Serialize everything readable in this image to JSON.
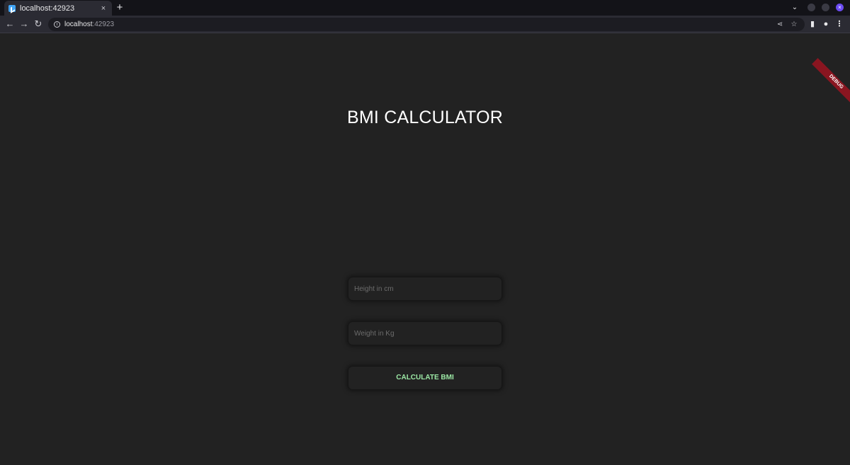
{
  "browser": {
    "tab": {
      "title": "localhost:42923",
      "close_glyph": "×"
    },
    "new_tab_glyph": "+",
    "tab_search_glyph": "⌄",
    "window_close_glyph": "×",
    "address": {
      "host": "localhost",
      "port": ":42923"
    },
    "nav": {
      "back_glyph": "←",
      "forward_glyph": "→",
      "reload_glyph": "↻"
    },
    "icons": {
      "share_glyph": "⋖",
      "star_glyph": "☆",
      "sidepanel_glyph": "▮",
      "profile_glyph": "●",
      "menu_glyph": "⋮"
    }
  },
  "debug_banner": "DEBUG",
  "app": {
    "title": "BMI CALCULATOR",
    "height_input": {
      "placeholder": "Height in cm",
      "value": ""
    },
    "weight_input": {
      "placeholder": "Weight in Kg",
      "value": ""
    },
    "calculate_button": "CALCULATE BMI"
  },
  "colors": {
    "background": "#222222",
    "button_text": "#9be7a4",
    "title_text": "#ffffff",
    "debug_ribbon": "#8a1520"
  }
}
